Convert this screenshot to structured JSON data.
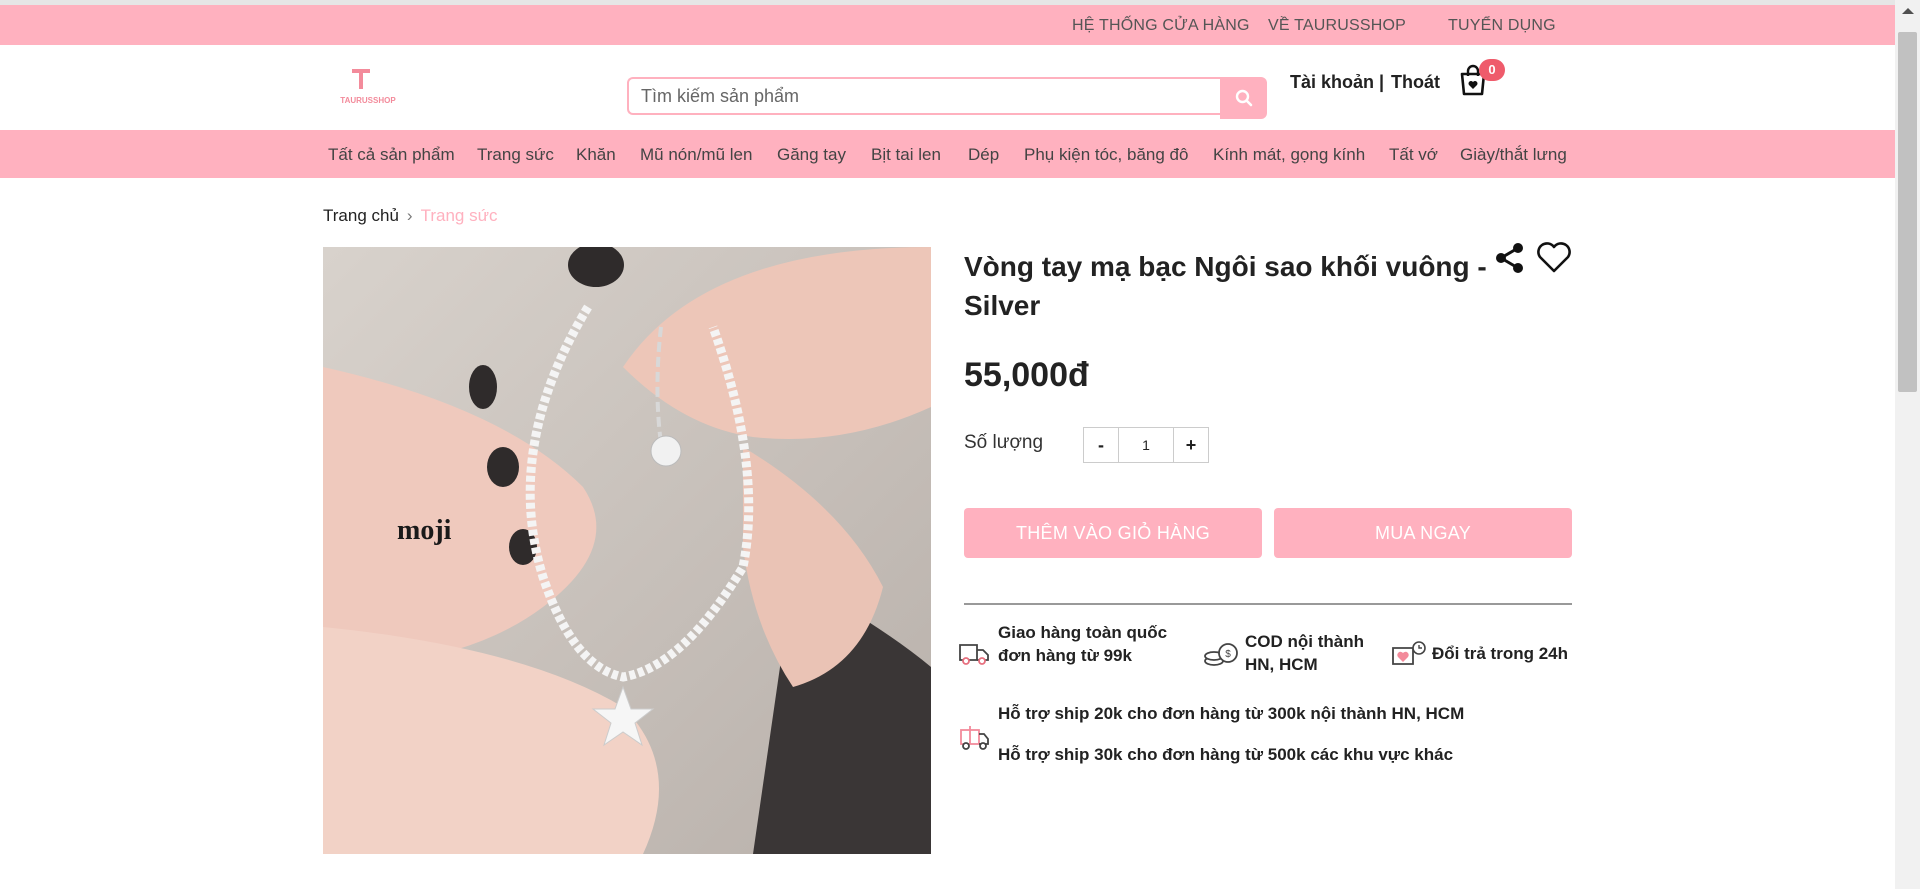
{
  "topbar": {
    "links": [
      "HỆ THỐNG CỬA HÀNG",
      "VỀ TAURUSSHOP",
      "TUYỂN DỤNG"
    ]
  },
  "header": {
    "logo_text": "TAURUSSHOP",
    "search_placeholder": "Tìm kiếm sản phẩm",
    "account_label": "Tài khoản |",
    "logout_label": "Thoát",
    "cart_count": "0"
  },
  "nav": {
    "items": [
      "Tất cả sản phẩm",
      "Trang sức",
      "Khăn",
      "Mũ nón/mũ len",
      "Găng tay",
      "Bịt tai len",
      "Dép",
      "Phụ kiện tóc, băng đô",
      "Kính mát, gọng kính",
      "Tất vớ",
      "Giày/thắt lưng"
    ]
  },
  "breadcrumb": {
    "home": "Trang chủ",
    "current": "Trang sức"
  },
  "product": {
    "image_watermark": "moji",
    "title": "Vòng tay mạ bạc Ngôi sao khối vuông - Silver",
    "price": "55,000đ",
    "quantity_label": "Số lượng",
    "quantity": "1",
    "minus": "-",
    "plus": "+",
    "add_to_cart": "THÊM VÀO GIỎ HÀNG",
    "buy_now": "MUA NGAY"
  },
  "features": {
    "delivery_line1": "Giao hàng toàn quốc",
    "delivery_line2": "đơn hàng từ 99k",
    "cod_line1": "COD nội thành",
    "cod_line2": "HN, HCM",
    "return": "Đổi trả trong 24h",
    "ship1": "Hỗ trợ ship 20k cho đơn hàng từ 300k nội thành HN, HCM",
    "ship2": "Hỗ trợ ship 30k cho đơn hàng từ 500k các khu vực khác"
  },
  "colors": {
    "brand_pink": "#ffb1bf",
    "badge_red": "#ef5b6b"
  }
}
